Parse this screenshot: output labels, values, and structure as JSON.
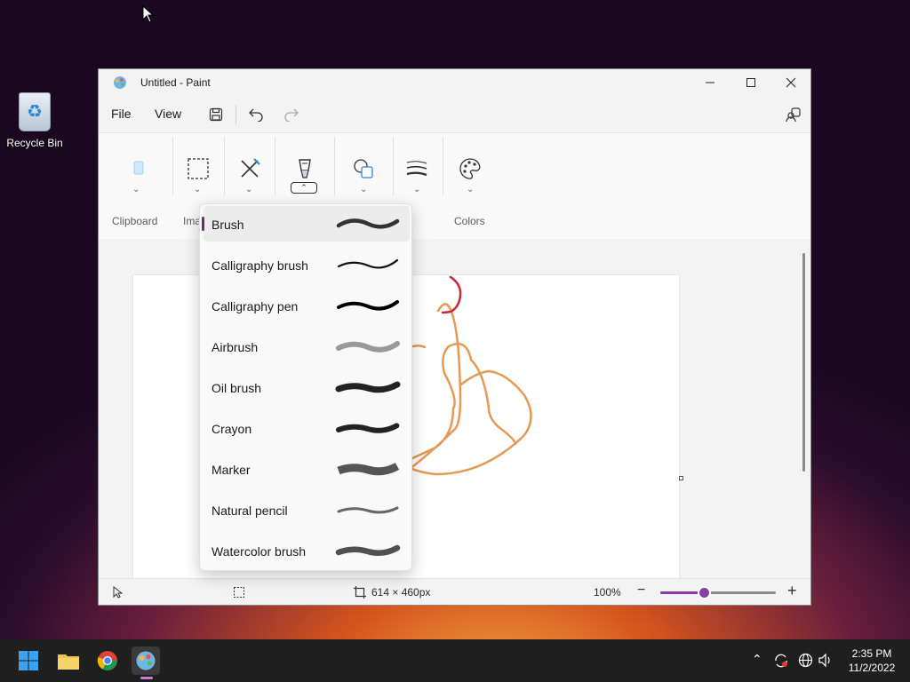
{
  "desktop": {
    "recycle_bin_label": "Recycle Bin"
  },
  "window": {
    "title": "Untitled - Paint",
    "menus": {
      "file": "File",
      "view": "View"
    },
    "controls": {
      "minimize_icon": "minimize-icon",
      "maximize_icon": "maximize-icon",
      "close_icon": "close-icon"
    }
  },
  "ribbon": {
    "groups": {
      "clipboard": "Clipboard",
      "image": "Ima",
      "size": "ize",
      "colors": "Colors"
    }
  },
  "brush_menu": {
    "items": [
      {
        "label": "Brush",
        "stroke": "brush"
      },
      {
        "label": "Calligraphy brush",
        "stroke": "calligraphy-brush"
      },
      {
        "label": "Calligraphy pen",
        "stroke": "calligraphy-pen"
      },
      {
        "label": "Airbrush",
        "stroke": "airbrush"
      },
      {
        "label": "Oil brush",
        "stroke": "oil-brush"
      },
      {
        "label": "Crayon",
        "stroke": "crayon"
      },
      {
        "label": "Marker",
        "stroke": "marker"
      },
      {
        "label": "Natural pencil",
        "stroke": "natural-pencil"
      },
      {
        "label": "Watercolor brush",
        "stroke": "watercolor-brush"
      }
    ],
    "selected": "Brush"
  },
  "status": {
    "canvas_size": "614 × 460px",
    "zoom": "100%",
    "zoom_fraction": 0.38
  },
  "taskbar": {
    "time": "2:35 PM",
    "date": "11/2/2022"
  },
  "colors": {
    "accent": "#8a3ca8",
    "stroke_orange": "#e39a56",
    "stroke_red": "#c8283c"
  }
}
